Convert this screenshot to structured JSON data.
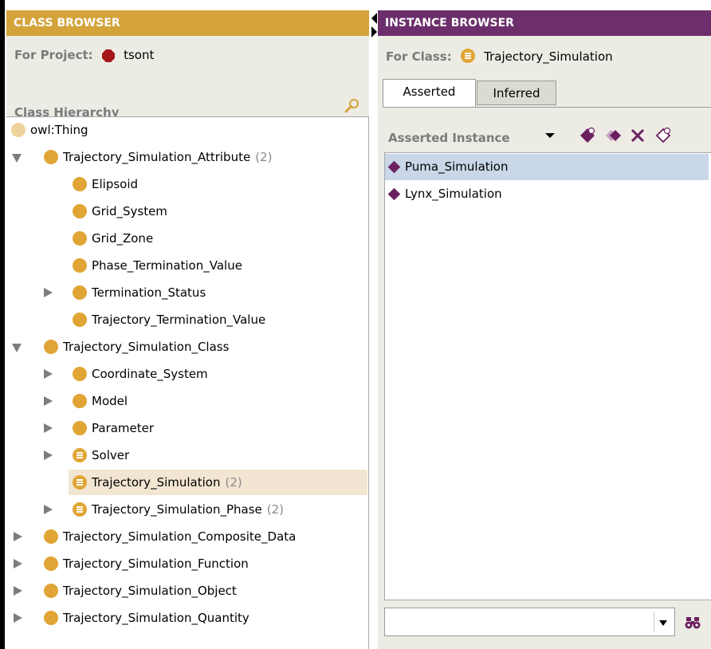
{
  "class_browser": {
    "title": "CLASS BROWSER",
    "project_label": "For Project:",
    "project_name": "tsont",
    "hierarchy_label": "Class Hierarchy",
    "tree": [
      {
        "label": "owl:Thing",
        "count": "",
        "depth": 0,
        "arrow": "none",
        "icon": "class-light-icon"
      },
      {
        "label": "Trajectory_Simulation_Attribute",
        "count": "(2)",
        "depth": 1,
        "arrow": "down",
        "icon": "class-icon"
      },
      {
        "label": "Elipsoid",
        "count": "",
        "depth": 2,
        "arrow": "none",
        "icon": "class-icon"
      },
      {
        "label": "Grid_System",
        "count": "",
        "depth": 2,
        "arrow": "none",
        "icon": "class-icon"
      },
      {
        "label": "Grid_Zone",
        "count": "",
        "depth": 2,
        "arrow": "none",
        "icon": "class-icon"
      },
      {
        "label": "Phase_Termination_Value",
        "count": "",
        "depth": 2,
        "arrow": "none",
        "icon": "class-icon"
      },
      {
        "label": "Termination_Status",
        "count": "",
        "depth": 2,
        "arrow": "right",
        "icon": "class-icon"
      },
      {
        "label": "Trajectory_Termination_Value",
        "count": "",
        "depth": 2,
        "arrow": "none",
        "icon": "class-icon"
      },
      {
        "label": "Trajectory_Simulation_Class",
        "count": "",
        "depth": 1,
        "arrow": "down",
        "icon": "class-icon"
      },
      {
        "label": "Coordinate_System",
        "count": "",
        "depth": 2,
        "arrow": "right",
        "icon": "class-icon"
      },
      {
        "label": "Model",
        "count": "",
        "depth": 2,
        "arrow": "right",
        "icon": "class-icon"
      },
      {
        "label": "Parameter",
        "count": "",
        "depth": 2,
        "arrow": "right",
        "icon": "class-icon"
      },
      {
        "label": "Solver",
        "count": "",
        "depth": 2,
        "arrow": "right",
        "icon": "defined-class-icon"
      },
      {
        "label": "Trajectory_Simulation",
        "count": "(2)",
        "depth": 2,
        "arrow": "none",
        "icon": "defined-class-icon",
        "selected": true
      },
      {
        "label": "Trajectory_Simulation_Phase",
        "count": "(2)",
        "depth": 2,
        "arrow": "right",
        "icon": "defined-class-icon"
      },
      {
        "label": "Trajectory_Simulation_Composite_Data",
        "count": "",
        "depth": 1,
        "arrow": "right",
        "icon": "class-icon"
      },
      {
        "label": "Trajectory_Simulation_Function",
        "count": "",
        "depth": 1,
        "arrow": "right",
        "icon": "class-icon"
      },
      {
        "label": "Trajectory_Simulation_Object",
        "count": "",
        "depth": 1,
        "arrow": "right",
        "icon": "class-icon"
      },
      {
        "label": "Trajectory_Simulation_Quantity",
        "count": "",
        "depth": 1,
        "arrow": "right",
        "icon": "class-icon"
      }
    ]
  },
  "instance_browser": {
    "title": "INSTANCE BROWSER",
    "class_label": "For Class:",
    "class_name": "Trajectory_Simulation",
    "tabs": [
      {
        "label": "Asserted"
      },
      {
        "label": "Inferred"
      }
    ],
    "asserted_label": "Asserted Instance",
    "toolbar_icons": [
      "dropdown-arrow-icon",
      "create-instance-icon",
      "copy-instance-icon",
      "delete-instance-icon",
      "add-type-icon"
    ],
    "instances": [
      {
        "label": "Puma_Simulation",
        "selected": true
      },
      {
        "label": "Lynx_Simulation",
        "selected": false
      }
    ],
    "search_value": "",
    "search_icon": "binoculars-icon"
  },
  "colors": {
    "class_header": "#d4a339",
    "instance_header": "#6c2f6b",
    "class_icon": "#e1a535",
    "instance_icon": "#6a2060",
    "selection_tree": "#f2e6d2",
    "selection_list": "#c9d7e8"
  }
}
